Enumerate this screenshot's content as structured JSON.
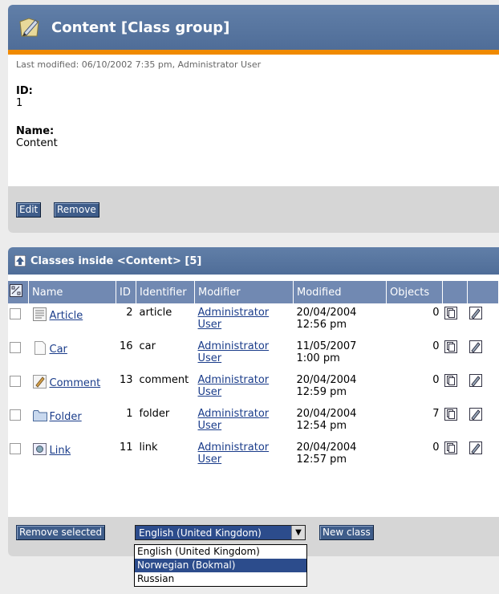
{
  "header": {
    "title": "Content [Class group]"
  },
  "info": {
    "last_modified": "Last modified: 06/10/2002 7:35 pm, Administrator User",
    "id_label": "ID:",
    "id_value": "1",
    "name_label": "Name:",
    "name_value": "Content"
  },
  "actions": {
    "edit": "Edit",
    "remove": "Remove"
  },
  "classes": {
    "title": "Classes inside <Content> [5]",
    "columns": [
      "Name",
      "ID",
      "Identifier",
      "Modifier",
      "Modified",
      "Objects"
    ],
    "rows": [
      {
        "name": "Article",
        "id": "2",
        "identifier": "article",
        "modifier_1": "Administrator",
        "modifier_2": "User",
        "date": "20/04/2004",
        "time": "12:56 pm",
        "objects": "0",
        "icon": "article-icon"
      },
      {
        "name": "Car",
        "id": "16",
        "identifier": "car",
        "modifier_1": "Administrator",
        "modifier_2": "User",
        "date": "11/05/2007",
        "time": "1:00 pm",
        "objects": "0",
        "icon": "page-icon"
      },
      {
        "name": "Comment",
        "id": "13",
        "identifier": "comment",
        "modifier_1": "Administrator",
        "modifier_2": "User",
        "date": "20/04/2004",
        "time": "12:59 pm",
        "objects": "0",
        "icon": "comment-icon"
      },
      {
        "name": "Folder",
        "id": "1",
        "identifier": "folder",
        "modifier_1": "Administrator",
        "modifier_2": "User",
        "date": "20/04/2004",
        "time": "12:54 pm",
        "objects": "7",
        "icon": "folder-icon"
      },
      {
        "name": "Link",
        "id": "11",
        "identifier": "link",
        "modifier_1": "Administrator",
        "modifier_2": "User",
        "date": "20/04/2004",
        "time": "12:57 pm",
        "objects": "0",
        "icon": "link-icon"
      }
    ]
  },
  "bottom": {
    "remove_selected": "Remove selected",
    "language_selected": "English (United Kingdom)",
    "new_class": "New class",
    "language_options": [
      "English (United Kingdom)",
      "Norwegian (Bokmal)",
      "Russian"
    ],
    "highlighted_option": "Norwegian (Bokmal)"
  },
  "colors": {
    "accent": "#f08a00",
    "header": "#5573a0",
    "button": "#3f5d8a"
  }
}
